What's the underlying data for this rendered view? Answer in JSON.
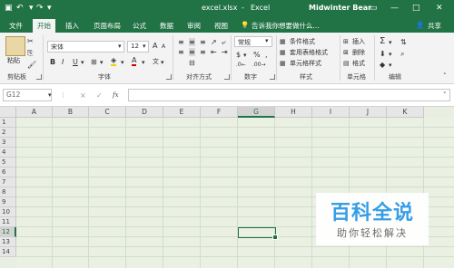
{
  "titlebar": {
    "filename": "excel.xlsx",
    "separator": "-",
    "app": "Excel",
    "user": "Midwinter Bear",
    "undo_icon": "undo-icon",
    "redo_icon": "redo-icon"
  },
  "tabs": {
    "file": "文件",
    "home": "开始",
    "insert": "插入",
    "layout": "页面布局",
    "formulas": "公式",
    "data": "数据",
    "review": "审阅",
    "view": "视图",
    "tellme": "告诉我你想要做什么...",
    "share": "共享"
  },
  "ribbon": {
    "clipboard": {
      "paste": "粘贴",
      "label": "剪贴板"
    },
    "font": {
      "name": "宋体",
      "size": "12",
      "bold": "B",
      "italic": "I",
      "underline": "U",
      "grow": "A",
      "label": "字体"
    },
    "align": {
      "label": "对齐方式"
    },
    "number": {
      "format": "常规",
      "percent": "%",
      "comma": ",",
      "label": "数字"
    },
    "styles": {
      "cond": "条件格式",
      "table": "套用表格格式",
      "cell": "单元格样式",
      "label": "样式"
    },
    "cells": {
      "insert": "插入",
      "delete": "删除",
      "format": "格式",
      "label": "单元格"
    },
    "edit": {
      "sum": "Σ",
      "label": "编辑"
    }
  },
  "formula_bar": {
    "name_box": "G12",
    "cancel": "×",
    "enter": "✓",
    "fx": "fx",
    "content": ""
  },
  "grid": {
    "columns": [
      "A",
      "B",
      "C",
      "D",
      "E",
      "F",
      "G",
      "H",
      "I",
      "J",
      "K"
    ],
    "rows": [
      "1",
      "2",
      "3",
      "4",
      "5",
      "6",
      "7",
      "8",
      "9",
      "10",
      "11",
      "12",
      "13",
      "14"
    ],
    "selected": "G12"
  },
  "watermark": {
    "title": "百科全说",
    "subtitle": "助你轻松解决"
  },
  "colors": {
    "accent": "#217346",
    "sheet_bg": "#eaf1e3",
    "watermark_blue": "#2f9be8"
  }
}
